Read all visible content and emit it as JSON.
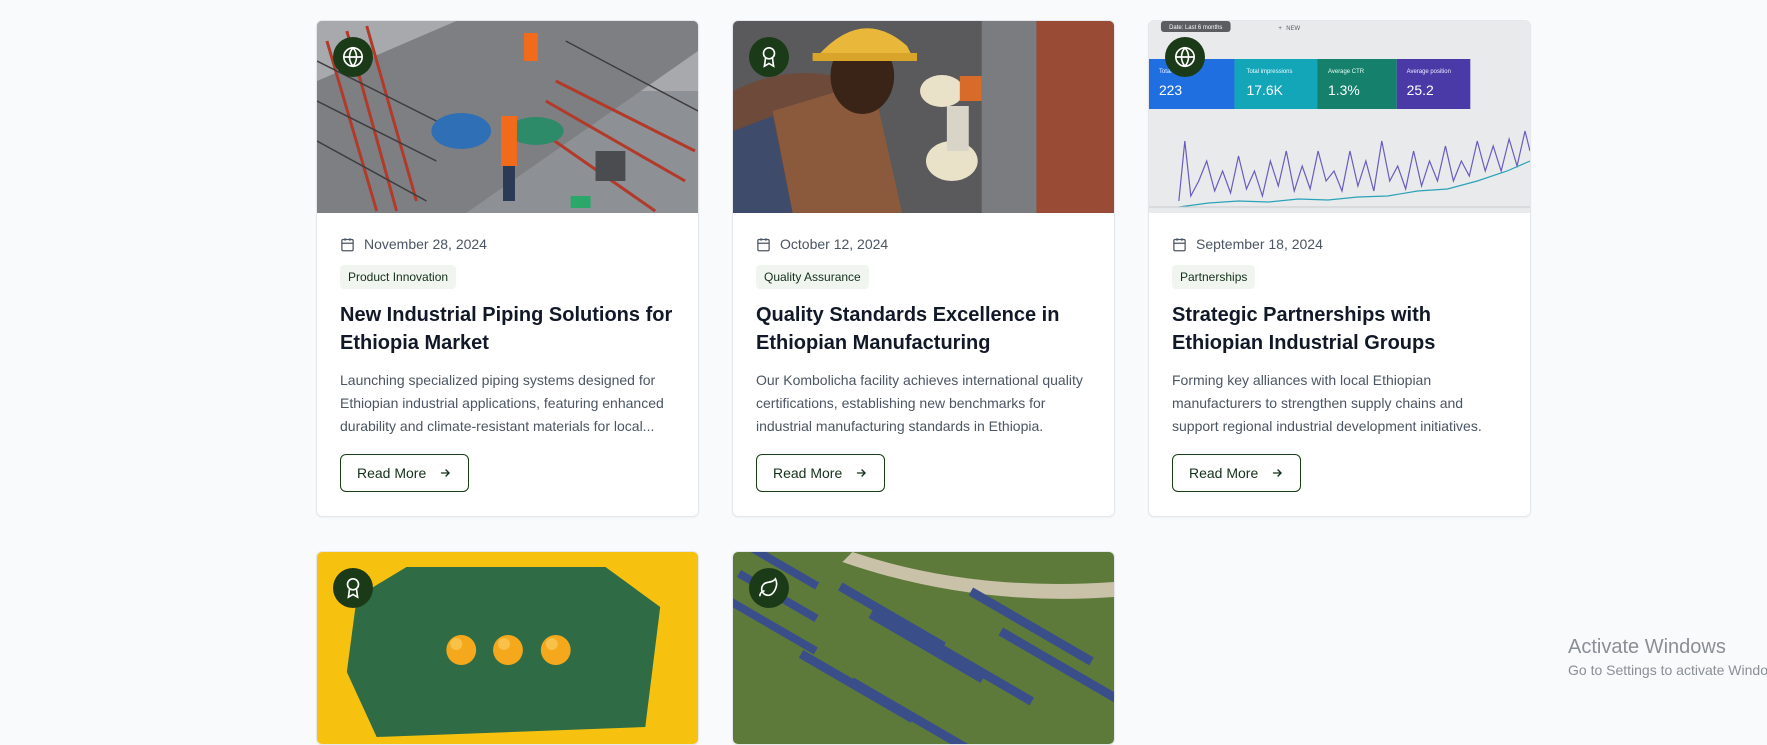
{
  "posts": [
    {
      "icon": "globe-icon",
      "date": "November 28, 2024",
      "category": "Product Innovation",
      "title": "New Industrial Piping Solutions for Ethiopia Market",
      "excerpt": "Launching specialized piping systems designed for Ethiopian industrial applications, featuring enhanced durability and climate-resistant materials for local...",
      "cta": "Read More"
    },
    {
      "icon": "award-icon",
      "date": "October 12, 2024",
      "category": "Quality Assurance",
      "title": "Quality Standards Excellence in Ethiopian Manufacturing",
      "excerpt": "Our Kombolicha facility achieves international quality certifications, establishing new benchmarks for industrial manufacturing standards in Ethiopia.",
      "cta": "Read More"
    },
    {
      "icon": "globe-icon",
      "date": "September 18, 2024",
      "category": "Partnerships",
      "title": "Strategic Partnerships with Ethiopian Industrial Groups",
      "excerpt": "Forming key alliances with local Ethiopian manufacturers to strengthen supply chains and support regional industrial development initiatives.",
      "cta": "Read More"
    },
    {
      "icon": "award-icon"
    },
    {
      "icon": "leaf-icon"
    }
  ],
  "analytics_image": {
    "chips": [
      "Date: Last 6 months",
      "NEW"
    ],
    "metrics": [
      {
        "label": "Total clicks",
        "value": "223"
      },
      {
        "label": "Total impressions",
        "value": "17.6K"
      },
      {
        "label": "Average CTR",
        "value": "1.3%"
      },
      {
        "label": "Average position",
        "value": "25.2"
      }
    ]
  },
  "watermark": {
    "title": "Activate Windows",
    "subtitle": "Go to Settings to activate Windows."
  },
  "colors": {
    "brand": "#1b3a17",
    "tag_bg": "#f1f5f0"
  }
}
